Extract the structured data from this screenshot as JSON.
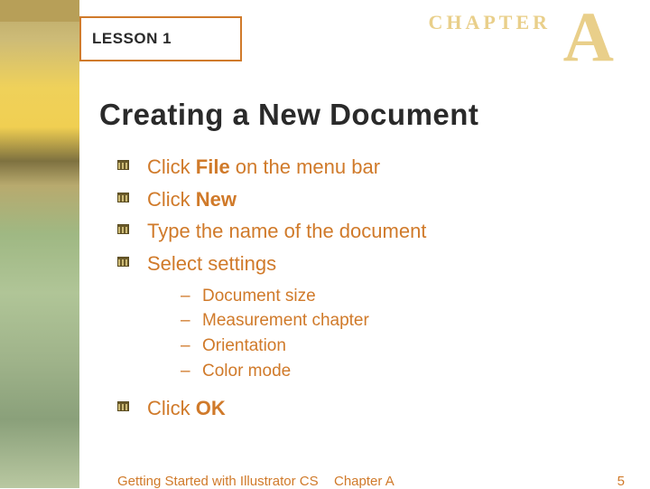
{
  "header": {
    "lesson_label": "LESSON 1",
    "chapter_word": "CHAPTER",
    "chapter_letter": "A"
  },
  "title": "Creating a New Document",
  "bullets": [
    {
      "pre": "Click ",
      "bold": "File",
      "post": " on the menu bar"
    },
    {
      "pre": "Click ",
      "bold": "New",
      "post": ""
    },
    {
      "pre": "Type the name of the document",
      "bold": "",
      "post": ""
    },
    {
      "pre": "Select settings",
      "bold": "",
      "post": ""
    }
  ],
  "sub_bullets": [
    "Document size",
    "Measurement chapter",
    "Orientation",
    "Color mode"
  ],
  "final_bullet": {
    "pre": "Click ",
    "bold": "OK",
    "post": ""
  },
  "footer": {
    "left": "Getting Started with Illustrator CS",
    "center": "Chapter A",
    "page": "5"
  }
}
